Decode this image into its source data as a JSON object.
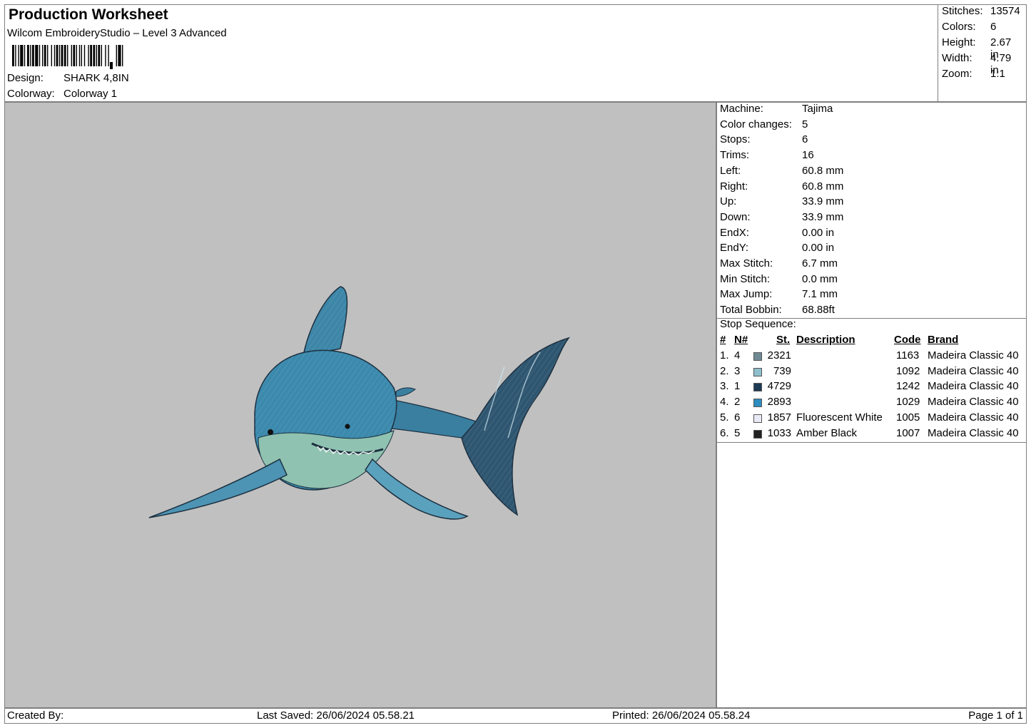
{
  "header": {
    "title": "Production Worksheet",
    "subtitle": "Wilcom EmbroideryStudio – Level 3 Advanced",
    "design_label": "Design:",
    "design_value": "SHARK 4,8IN",
    "colorway_label": "Colorway:",
    "colorway_value": "Colorway 1"
  },
  "stats": {
    "stitches_label": "Stitches:",
    "stitches": "13574",
    "colors_label": "Colors:",
    "colors": "6",
    "height_label": "Height:",
    "height": "2.67 in",
    "width_label": "Width:",
    "width": "4.79 in",
    "zoom_label": "Zoom:",
    "zoom": "1:1"
  },
  "machine_info": [
    {
      "label": "Machine:",
      "value": "Tajima"
    },
    {
      "label": "Color changes:",
      "value": "5"
    },
    {
      "label": "Stops:",
      "value": "6"
    },
    {
      "label": "Trims:",
      "value": "16"
    },
    {
      "label": "Left:",
      "value": "60.8 mm"
    },
    {
      "label": "Right:",
      "value": "60.8 mm"
    },
    {
      "label": "Up:",
      "value": "33.9 mm"
    },
    {
      "label": "Down:",
      "value": "33.9 mm"
    },
    {
      "label": "EndX:",
      "value": "0.00 in"
    },
    {
      "label": "EndY:",
      "value": "0.00 in"
    },
    {
      "label": "Max Stitch:",
      "value": "6.7 mm"
    },
    {
      "label": "Min Stitch:",
      "value": "0.0 mm"
    },
    {
      "label": "Max Jump:",
      "value": "7.1 mm"
    },
    {
      "label": "Total Bobbin:",
      "value": "68.88ft"
    }
  ],
  "stop_sequence": {
    "title": "Stop Sequence:",
    "headers": {
      "num": "#",
      "n": "N#",
      "st": "St.",
      "description": "Description",
      "code": "Code",
      "brand": "Brand"
    },
    "rows": [
      {
        "num": "1.",
        "n": "4",
        "color": "#6f8a93",
        "st": "2321",
        "description": "",
        "code": "1163",
        "brand": "Madeira Classic 40"
      },
      {
        "num": "2.",
        "n": "3",
        "color": "#8fbfcc",
        "st": "739",
        "description": "",
        "code": "1092",
        "brand": "Madeira Classic 40"
      },
      {
        "num": "3.",
        "n": "1",
        "color": "#1d3a55",
        "st": "4729",
        "description": "",
        "code": "1242",
        "brand": "Madeira Classic 40"
      },
      {
        "num": "4.",
        "n": "2",
        "color": "#2d8dc0",
        "st": "2893",
        "description": "",
        "code": "1029",
        "brand": "Madeira Classic 40"
      },
      {
        "num": "5.",
        "n": "6",
        "color": "#e8eaf8",
        "st": "1857",
        "description": "Fluorescent White",
        "code": "1005",
        "brand": "Madeira Classic 40"
      },
      {
        "num": "6.",
        "n": "5",
        "color": "#222222",
        "st": "1033",
        "description": "Amber Black",
        "code": "1007",
        "brand": "Madeira Classic 40"
      }
    ]
  },
  "footer": {
    "created_by": "Created By:",
    "last_saved": "Last Saved: 26/06/2024 05.58.21",
    "printed": "Printed: 26/06/2024 05.58.24",
    "page": "Page 1 of 1"
  },
  "design_preview": {
    "background": "#c0c0c0"
  }
}
